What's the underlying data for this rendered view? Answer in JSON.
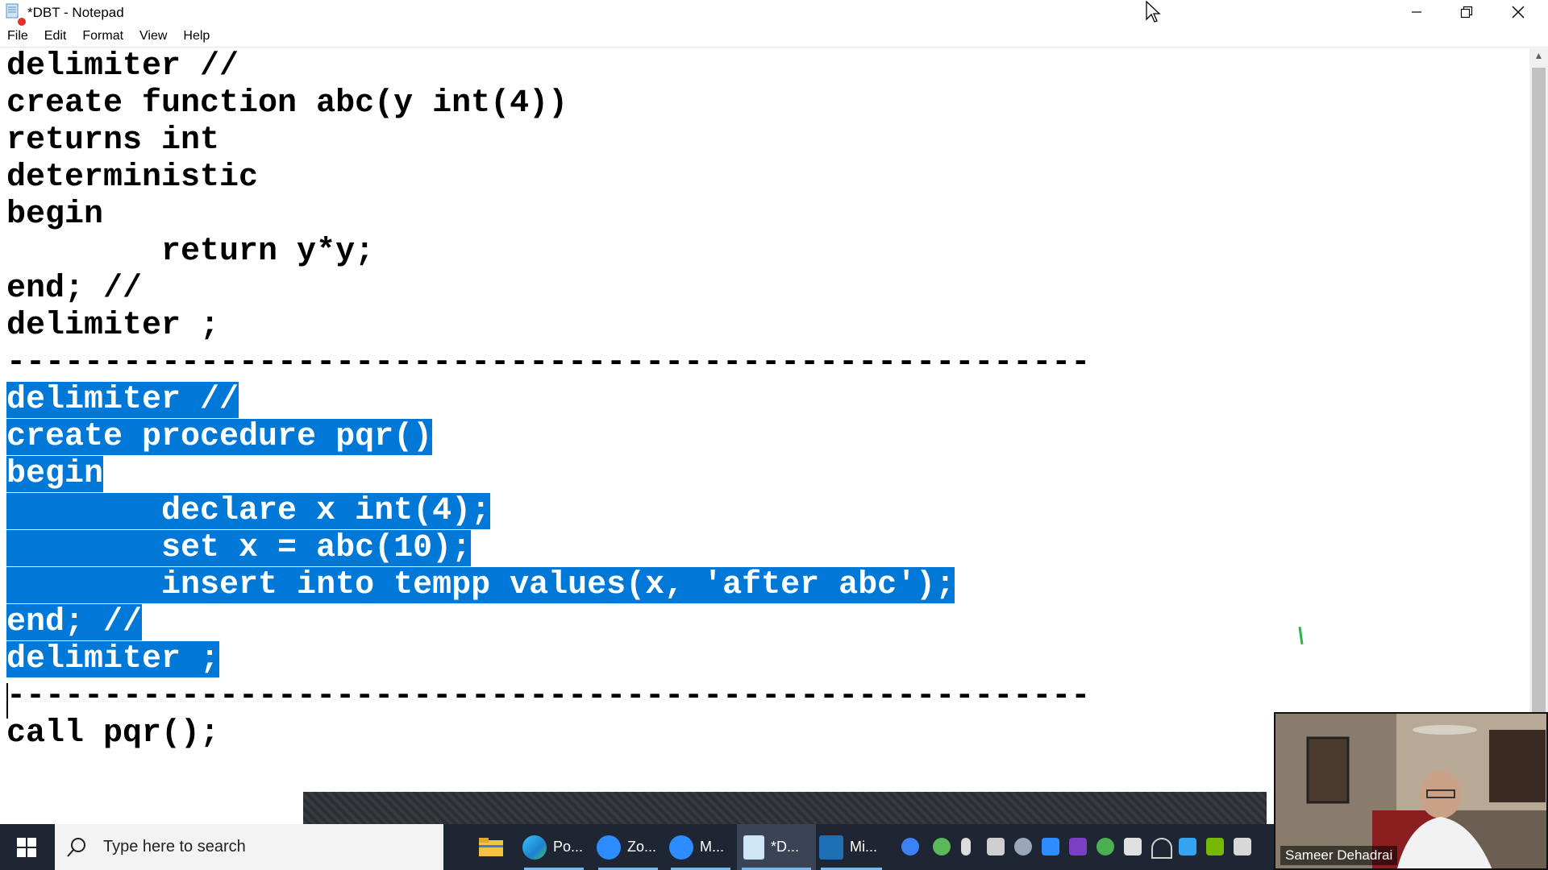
{
  "window": {
    "title": "*DBT - Notepad",
    "minimize_icon": "minimize-icon",
    "restore_icon": "restore-icon",
    "close_icon": "close-icon"
  },
  "menu": [
    "File",
    "Edit",
    "Format",
    "View",
    "Help"
  ],
  "editor": {
    "lines": [
      "delimiter //",
      "create function abc(y int(4))",
      "returns int",
      "deterministic",
      "begin",
      "        return y*y;",
      "end; //",
      "delimiter ;",
      "--------------------------------------------------------",
      "delimiter //",
      "create procedure pqr()",
      "begin",
      "        declare x int(4);",
      "        set x = abc(10);",
      "        insert into tempp values(x, 'after abc');",
      "end; //",
      "delimiter ;",
      "--------------------------------------------------------",
      "call pqr();"
    ],
    "selected_lines": [
      9,
      10,
      11,
      12,
      13,
      14,
      15,
      16
    ],
    "selection_color": "#0078d7"
  },
  "taskbar": {
    "search_placeholder": "Type here to search",
    "apps": [
      {
        "icon": "file-explorer-icon",
        "label": ""
      },
      {
        "icon": "edge-icon",
        "label": "Po..."
      },
      {
        "icon": "zoom-icon",
        "label": "Zo..."
      },
      {
        "icon": "zoom-meeting-icon",
        "label": "M..."
      },
      {
        "icon": "notepad-icon",
        "label": "*D..."
      },
      {
        "icon": "mysql-workbench-icon",
        "label": "Mi..."
      }
    ],
    "background": "#1f2633"
  },
  "webcam": {
    "name": "Sameer Dehadrai"
  }
}
